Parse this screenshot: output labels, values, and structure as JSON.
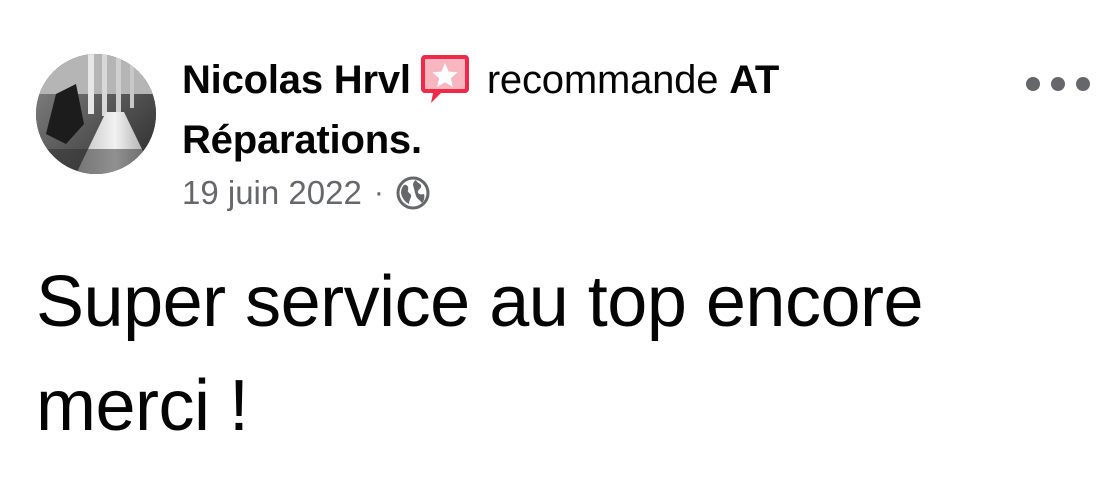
{
  "post": {
    "author_name": "Nicolas Hrvl",
    "badge_icon": "recommendation-star-icon",
    "badge_color": "#f02849",
    "recommend_word": "recommande",
    "page_name": "AT Réparations.",
    "date": "19 juin 2022",
    "separator": "·",
    "audience_icon": "globe-icon",
    "more_icon": "more-options-icon",
    "text": "Super service au top encore merci !"
  },
  "colors": {
    "text_primary": "#050505",
    "text_secondary": "#65676b"
  }
}
